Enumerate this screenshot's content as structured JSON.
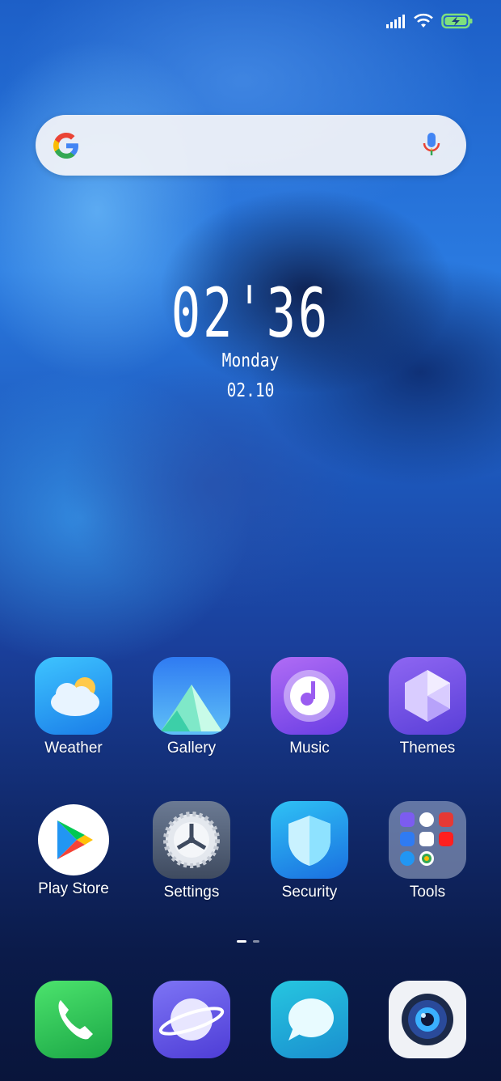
{
  "status_bar": {
    "signal_icon": "signal-icon",
    "wifi_icon": "wifi-icon",
    "battery_icon": "battery-charging-icon"
  },
  "search": {
    "logo": "google-g-icon",
    "mic": "mic-icon"
  },
  "clock": {
    "hours": "02",
    "separator": "ˈ",
    "minutes": "36",
    "day": "Monday",
    "date": "02.10"
  },
  "apps_row1": [
    {
      "label": "Weather",
      "icon": "weather-icon"
    },
    {
      "label": "Gallery",
      "icon": "gallery-icon"
    },
    {
      "label": "Music",
      "icon": "music-icon"
    },
    {
      "label": "Themes",
      "icon": "themes-icon"
    }
  ],
  "apps_row2": [
    {
      "label": "Play Store",
      "icon": "play-store-icon"
    },
    {
      "label": "Settings",
      "icon": "settings-icon"
    },
    {
      "label": "Security",
      "icon": "security-icon"
    },
    {
      "label": "Tools",
      "icon": "tools-folder-icon"
    }
  ],
  "page_indicator": {
    "pages": 2,
    "current": 1
  },
  "dock": [
    {
      "icon": "phone-icon"
    },
    {
      "icon": "browser-icon"
    },
    {
      "icon": "messages-icon"
    },
    {
      "icon": "camera-icon"
    }
  ]
}
